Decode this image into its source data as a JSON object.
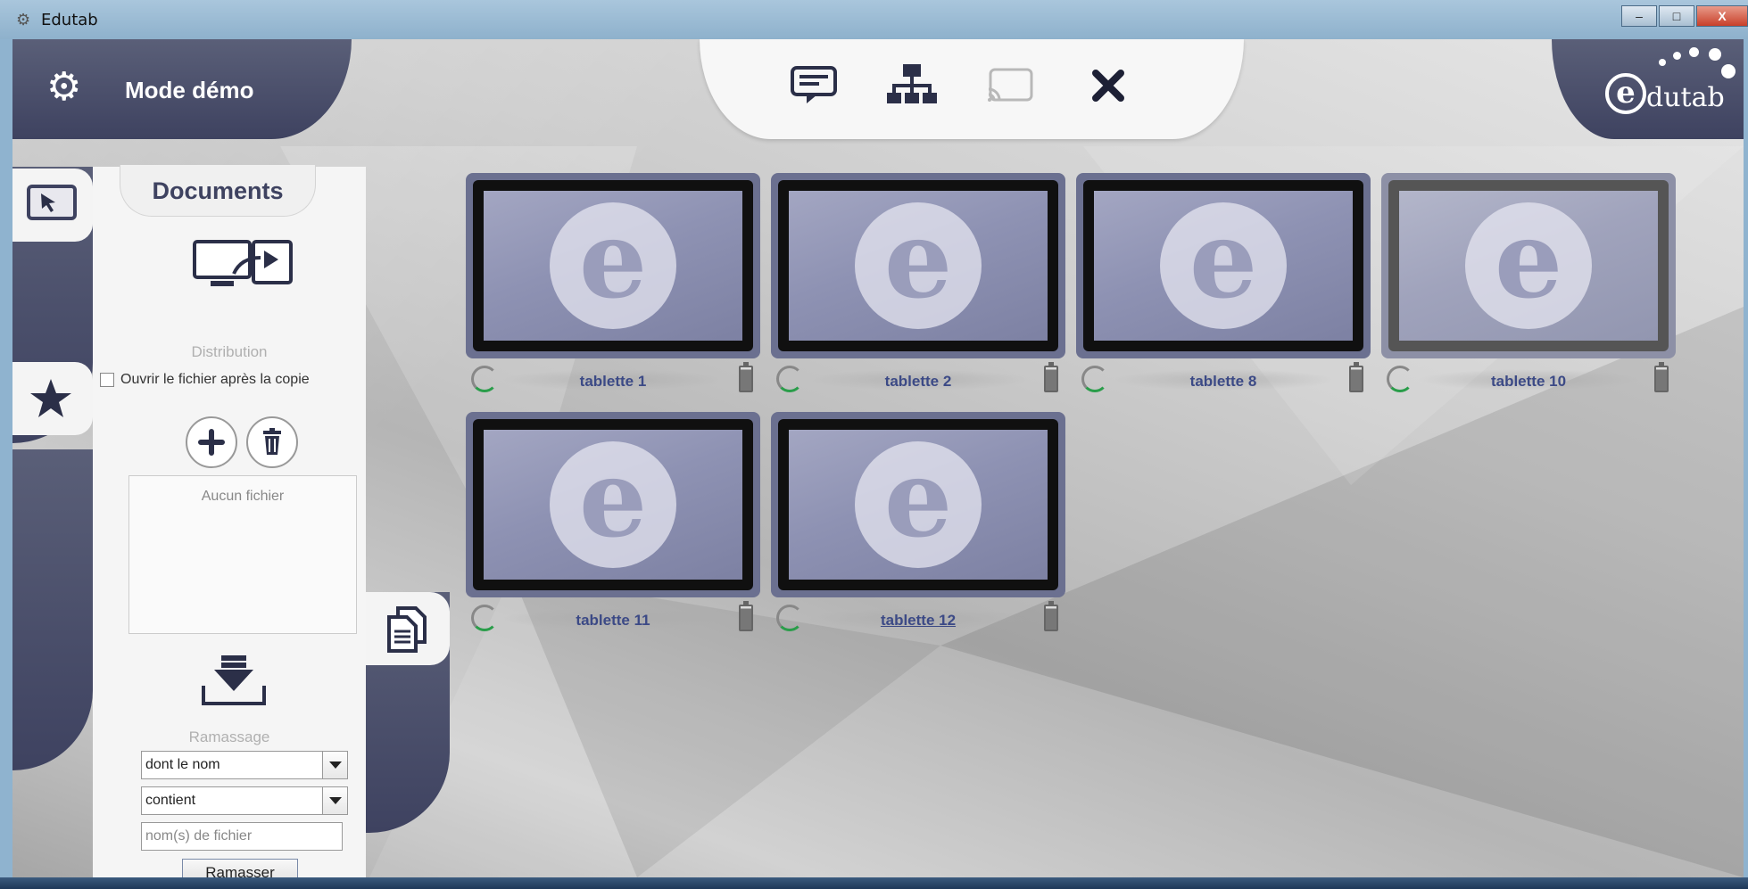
{
  "window": {
    "title": "Edutab",
    "app_icon": "gear-icon",
    "controls": {
      "minimize": "–",
      "maximize": "□",
      "close": "X"
    }
  },
  "header": {
    "settings_icon": "gear-icon",
    "mode_title": "Mode démo",
    "toolbar_icons": [
      "presentation-screen-icon",
      "network-hierarchy-icon",
      "cast-screen-icon",
      "close-x-icon"
    ],
    "logo": {
      "letter": "e",
      "text": "dutab"
    }
  },
  "left_tabs": [
    "cursor-screen-icon",
    "star-icon"
  ],
  "panel": {
    "title": "Documents",
    "distribution_label": "Distribution",
    "open_after_copy_label": "Ouvrir le fichier après la copie",
    "open_after_copy_checked": false,
    "add_icon": "plus-icon",
    "delete_icon": "trash-icon",
    "file_list_empty": "Aucun fichier",
    "collect_label": "Ramassage",
    "filter_field": {
      "selected": "dont le nom"
    },
    "filter_operator": {
      "selected": "contient"
    },
    "filename_input": {
      "value": "",
      "placeholder": "nom(s) de fichier"
    },
    "collect_button": "Ramasser"
  },
  "documents_tab_icon": "documents-icon",
  "tablets": [
    {
      "name": "tablette 1",
      "dimmed": false,
      "link": false
    },
    {
      "name": "tablette 2",
      "dimmed": false,
      "link": false
    },
    {
      "name": "tablette 8",
      "dimmed": false,
      "link": false
    },
    {
      "name": "tablette 10",
      "dimmed": true,
      "link": false
    },
    {
      "name": "tablette 11",
      "dimmed": false,
      "link": false
    },
    {
      "name": "tablette 12",
      "dimmed": false,
      "link": true
    }
  ],
  "colors": {
    "header_dark": "#3e4260",
    "tablet_label": "#3c4a86",
    "accent_green": "#2a9d4a"
  }
}
